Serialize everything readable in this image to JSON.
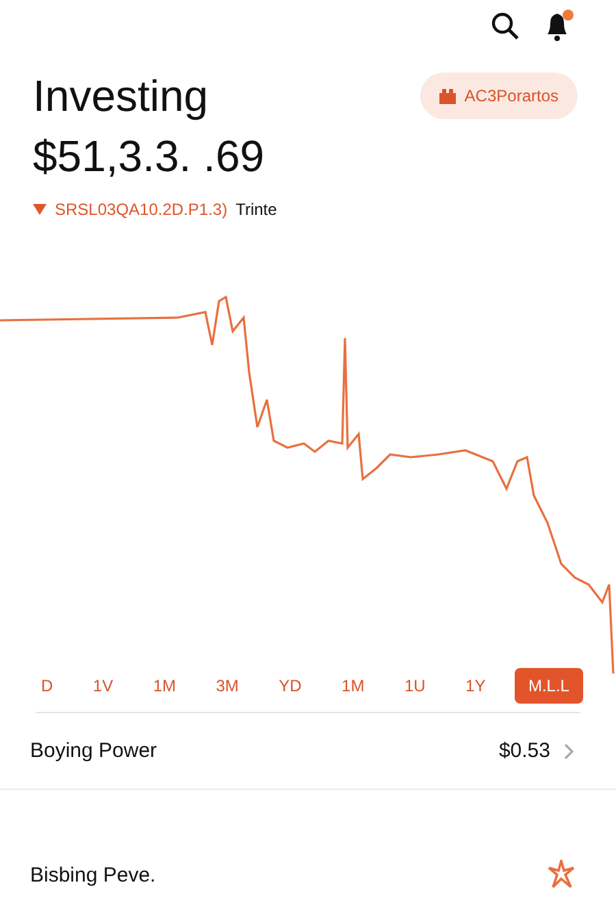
{
  "header": {
    "title": "Investing",
    "balance": "$51,3.3. .69",
    "change": "SRSL03QA10.2D.P1.3)",
    "change_period": "Trinte",
    "badge": "AC3Porartos"
  },
  "ranges": [
    {
      "label": "D",
      "selected": false
    },
    {
      "label": "1V",
      "selected": false
    },
    {
      "label": "1M",
      "selected": false
    },
    {
      "label": "3M",
      "selected": false
    },
    {
      "label": "YD",
      "selected": false
    },
    {
      "label": "1M",
      "selected": false
    },
    {
      "label": "1U",
      "selected": false
    },
    {
      "label": "1Y",
      "selected": false
    },
    {
      "label": "M.L.L",
      "selected": true
    }
  ],
  "rows": [
    {
      "label": "Boying Power",
      "value": "$0.53",
      "kind": "link"
    },
    {
      "label": "Bisbing Peve.",
      "kind": "icon"
    }
  ]
}
